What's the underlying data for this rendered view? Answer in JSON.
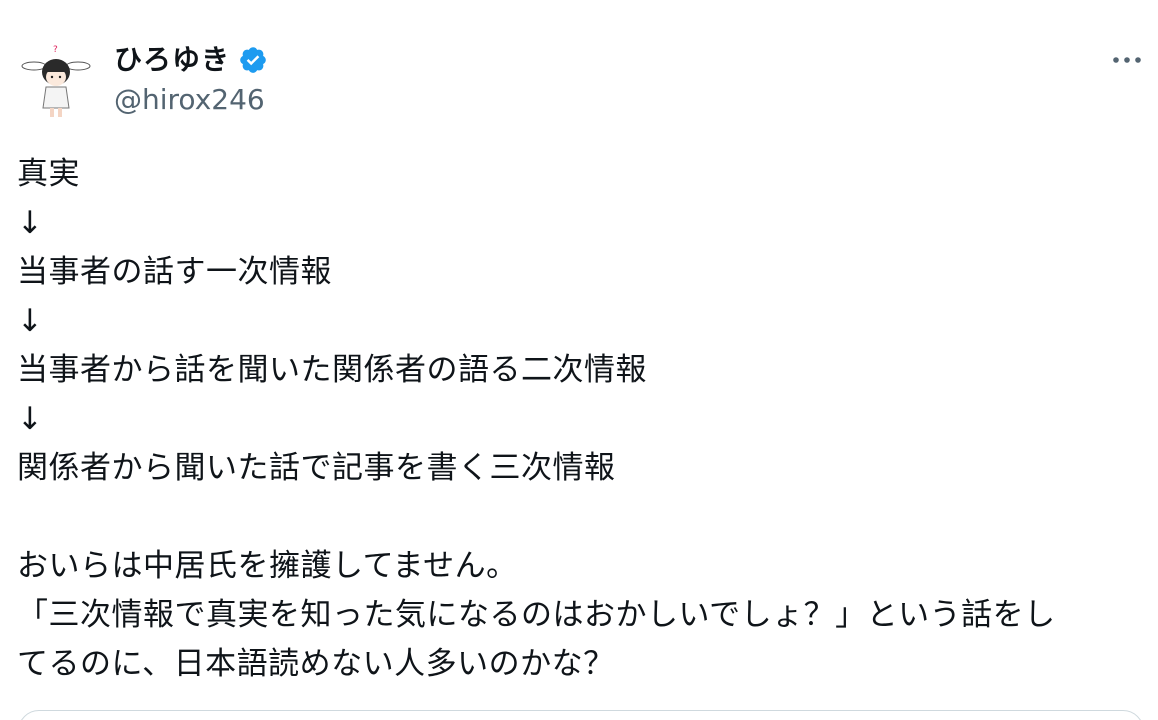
{
  "author": {
    "display_name": "ひろゆき",
    "handle": "@hirox246",
    "verified": true,
    "avatar_icon": "avatar-illustration-icon"
  },
  "menu": {
    "more_icon": "more-options-icon"
  },
  "tweet": {
    "lines": [
      "真実",
      "↓",
      "当事者の話す一次情報",
      "↓",
      "当事者から話を聞いた関係者の語る二次情報",
      "↓",
      "関係者から聞いた話で記事を書く三次情報",
      "",
      "おいらは中居氏を擁護してません。",
      "「三次情報で真実を知った気になるのはおかしいでしょ？」という話をし",
      "てるのに、日本語読めない人多いのかな？"
    ]
  },
  "colors": {
    "text": "#0f1419",
    "secondary": "#536471",
    "verified_blue": "#1d9bf0",
    "border": "#cfd9de"
  }
}
